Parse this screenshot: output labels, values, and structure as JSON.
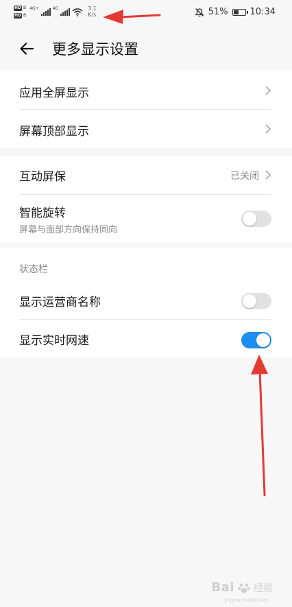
{
  "status_bar": {
    "hd_label": "HD",
    "hd_sub": "B",
    "network_type_1": "4G+",
    "network_type_2": "4G",
    "net_speed_value": "3.1",
    "net_speed_unit": "K/s",
    "battery_percent": "51%",
    "battery_level": 0.51,
    "time": "10:34",
    "icons": [
      "signal-icon",
      "wifi-icon",
      "mute-icon",
      "battery-icon"
    ]
  },
  "header": {
    "title": "更多显示设置"
  },
  "group1": {
    "items": [
      {
        "label": "应用全屏显示"
      },
      {
        "label": "屏幕顶部显示"
      }
    ]
  },
  "group2": {
    "screensaver": {
      "label": "互动屏保",
      "value": "已关闭"
    },
    "rotate": {
      "label": "智能旋转",
      "sublabel": "屏幕与面部方向保持同向",
      "enabled": false
    }
  },
  "group3": {
    "section_header": "状态栏",
    "carrier": {
      "label": "显示运营商名称",
      "enabled": false
    },
    "netspeed": {
      "label": "显示实时网速",
      "enabled": true
    }
  },
  "colors": {
    "accent": "#1e8ef2",
    "annotation": "#e53935",
    "background": "#f7f7f7"
  },
  "watermark": {
    "brand": "Bai",
    "sub": "经验",
    "url": "jingyan.baidu.com"
  }
}
